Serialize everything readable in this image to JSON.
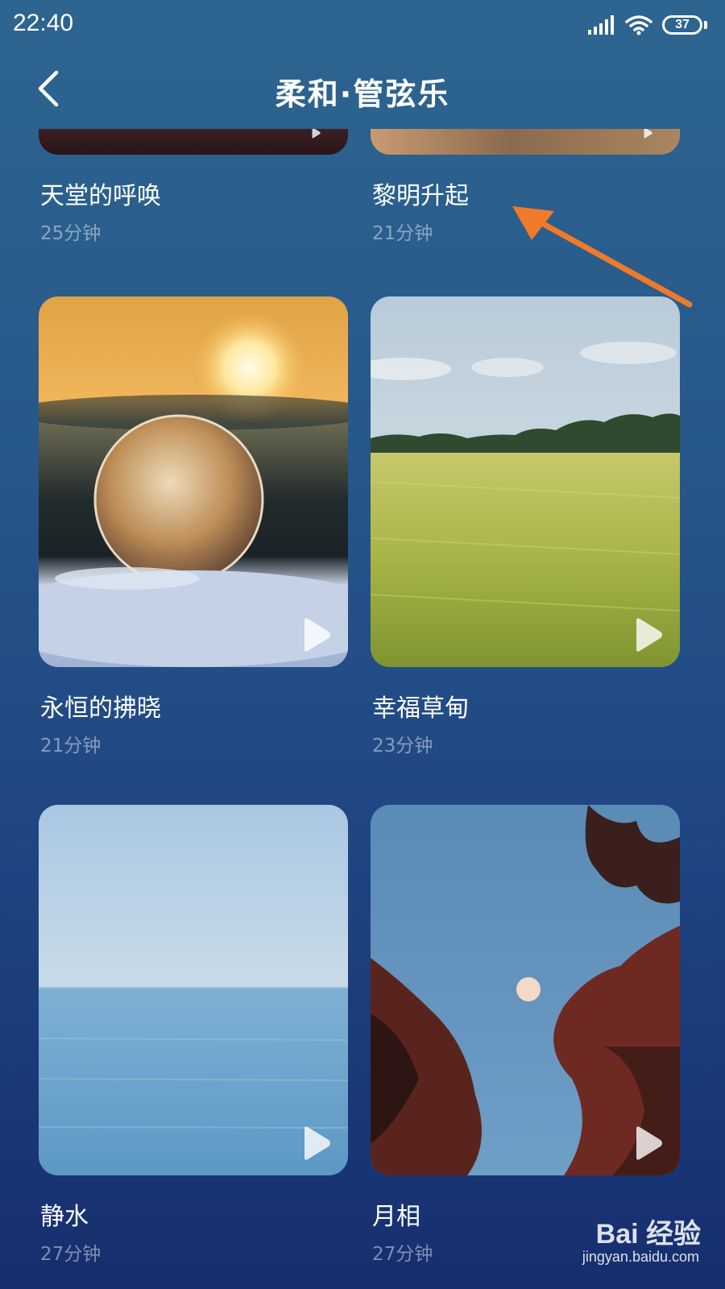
{
  "status_bar": {
    "time": "22:40",
    "battery": "37",
    "battery_level": 0.37,
    "icons": [
      "signal-icon",
      "wifi-icon",
      "battery-icon"
    ]
  },
  "header": {
    "title": "柔和·管弦乐",
    "back_icon": "chevron-left-icon"
  },
  "tracks": [
    {
      "title": "天堂的呼唤",
      "duration": "25分钟"
    },
    {
      "title": "黎明升起",
      "duration": "21分钟"
    },
    {
      "title": "永恒的拂晓",
      "duration": "21分钟"
    },
    {
      "title": "幸福草甸",
      "duration": "23分钟"
    },
    {
      "title": "静水",
      "duration": "27分钟"
    },
    {
      "title": "月相",
      "duration": "27分钟"
    }
  ],
  "annotation": {
    "color": "#f07a2a"
  },
  "watermark": {
    "brand": "Bai 经验",
    "url": "jingyan.baidu.com"
  },
  "colors": {
    "background_top": "#2e6590",
    "background_bottom": "#162e6e",
    "duration_text": "rgba(255,255,255,0.45)"
  }
}
